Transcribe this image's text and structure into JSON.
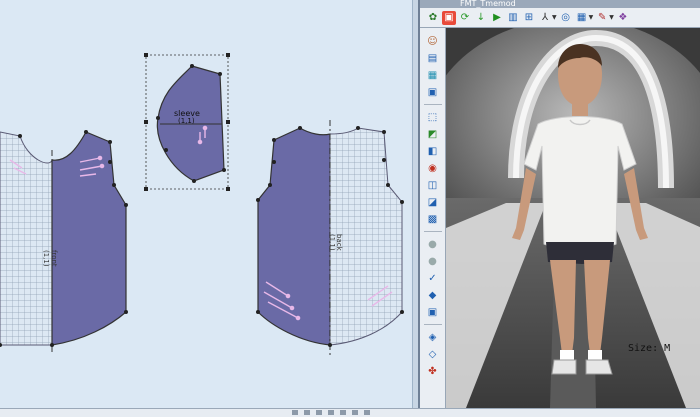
{
  "pattern_pieces": {
    "front": {
      "label": "front",
      "sub": "(1,1)"
    },
    "sleeve": {
      "label": "sleeve",
      "sub": "(1,1)"
    },
    "back": {
      "label": "back",
      "sub": "(1,1)"
    }
  },
  "simulation": {
    "window_title": "FMT_Tmemod",
    "size_label": "Size: M"
  },
  "colors": {
    "pattern_bg": "#dbe8f4",
    "piece_fill": "#6a6aa6",
    "grid_line": "#8fa0b4",
    "grain_marks": "#e8b8e8",
    "avatar_skin": "#c89a7c",
    "tshirt": "#f2f2f0",
    "shorts": "#2e2e38"
  },
  "toolbar": {
    "top_icons": [
      "pin-icon",
      "tshirt-icon",
      "refresh-icon",
      "down-arrow-icon",
      "play-icon",
      "frame-icon",
      "mesh-icon",
      "axis-icon",
      "target-icon",
      "grid-icon",
      "brush-icon",
      "cloth-icon"
    ],
    "side_icons": [
      "avatar-icon",
      "measure-icon",
      "layers-icon",
      "display-icon",
      "select-icon",
      "fold-icon",
      "pose-icon",
      "collision-icon",
      "fabric-icon",
      "texture-icon",
      "render-icon",
      "circle-icon",
      "circle-icon",
      "check-icon",
      "shape-icon",
      "camera-icon",
      "arrangement-icon",
      "shape-icon",
      "color-icon"
    ]
  }
}
